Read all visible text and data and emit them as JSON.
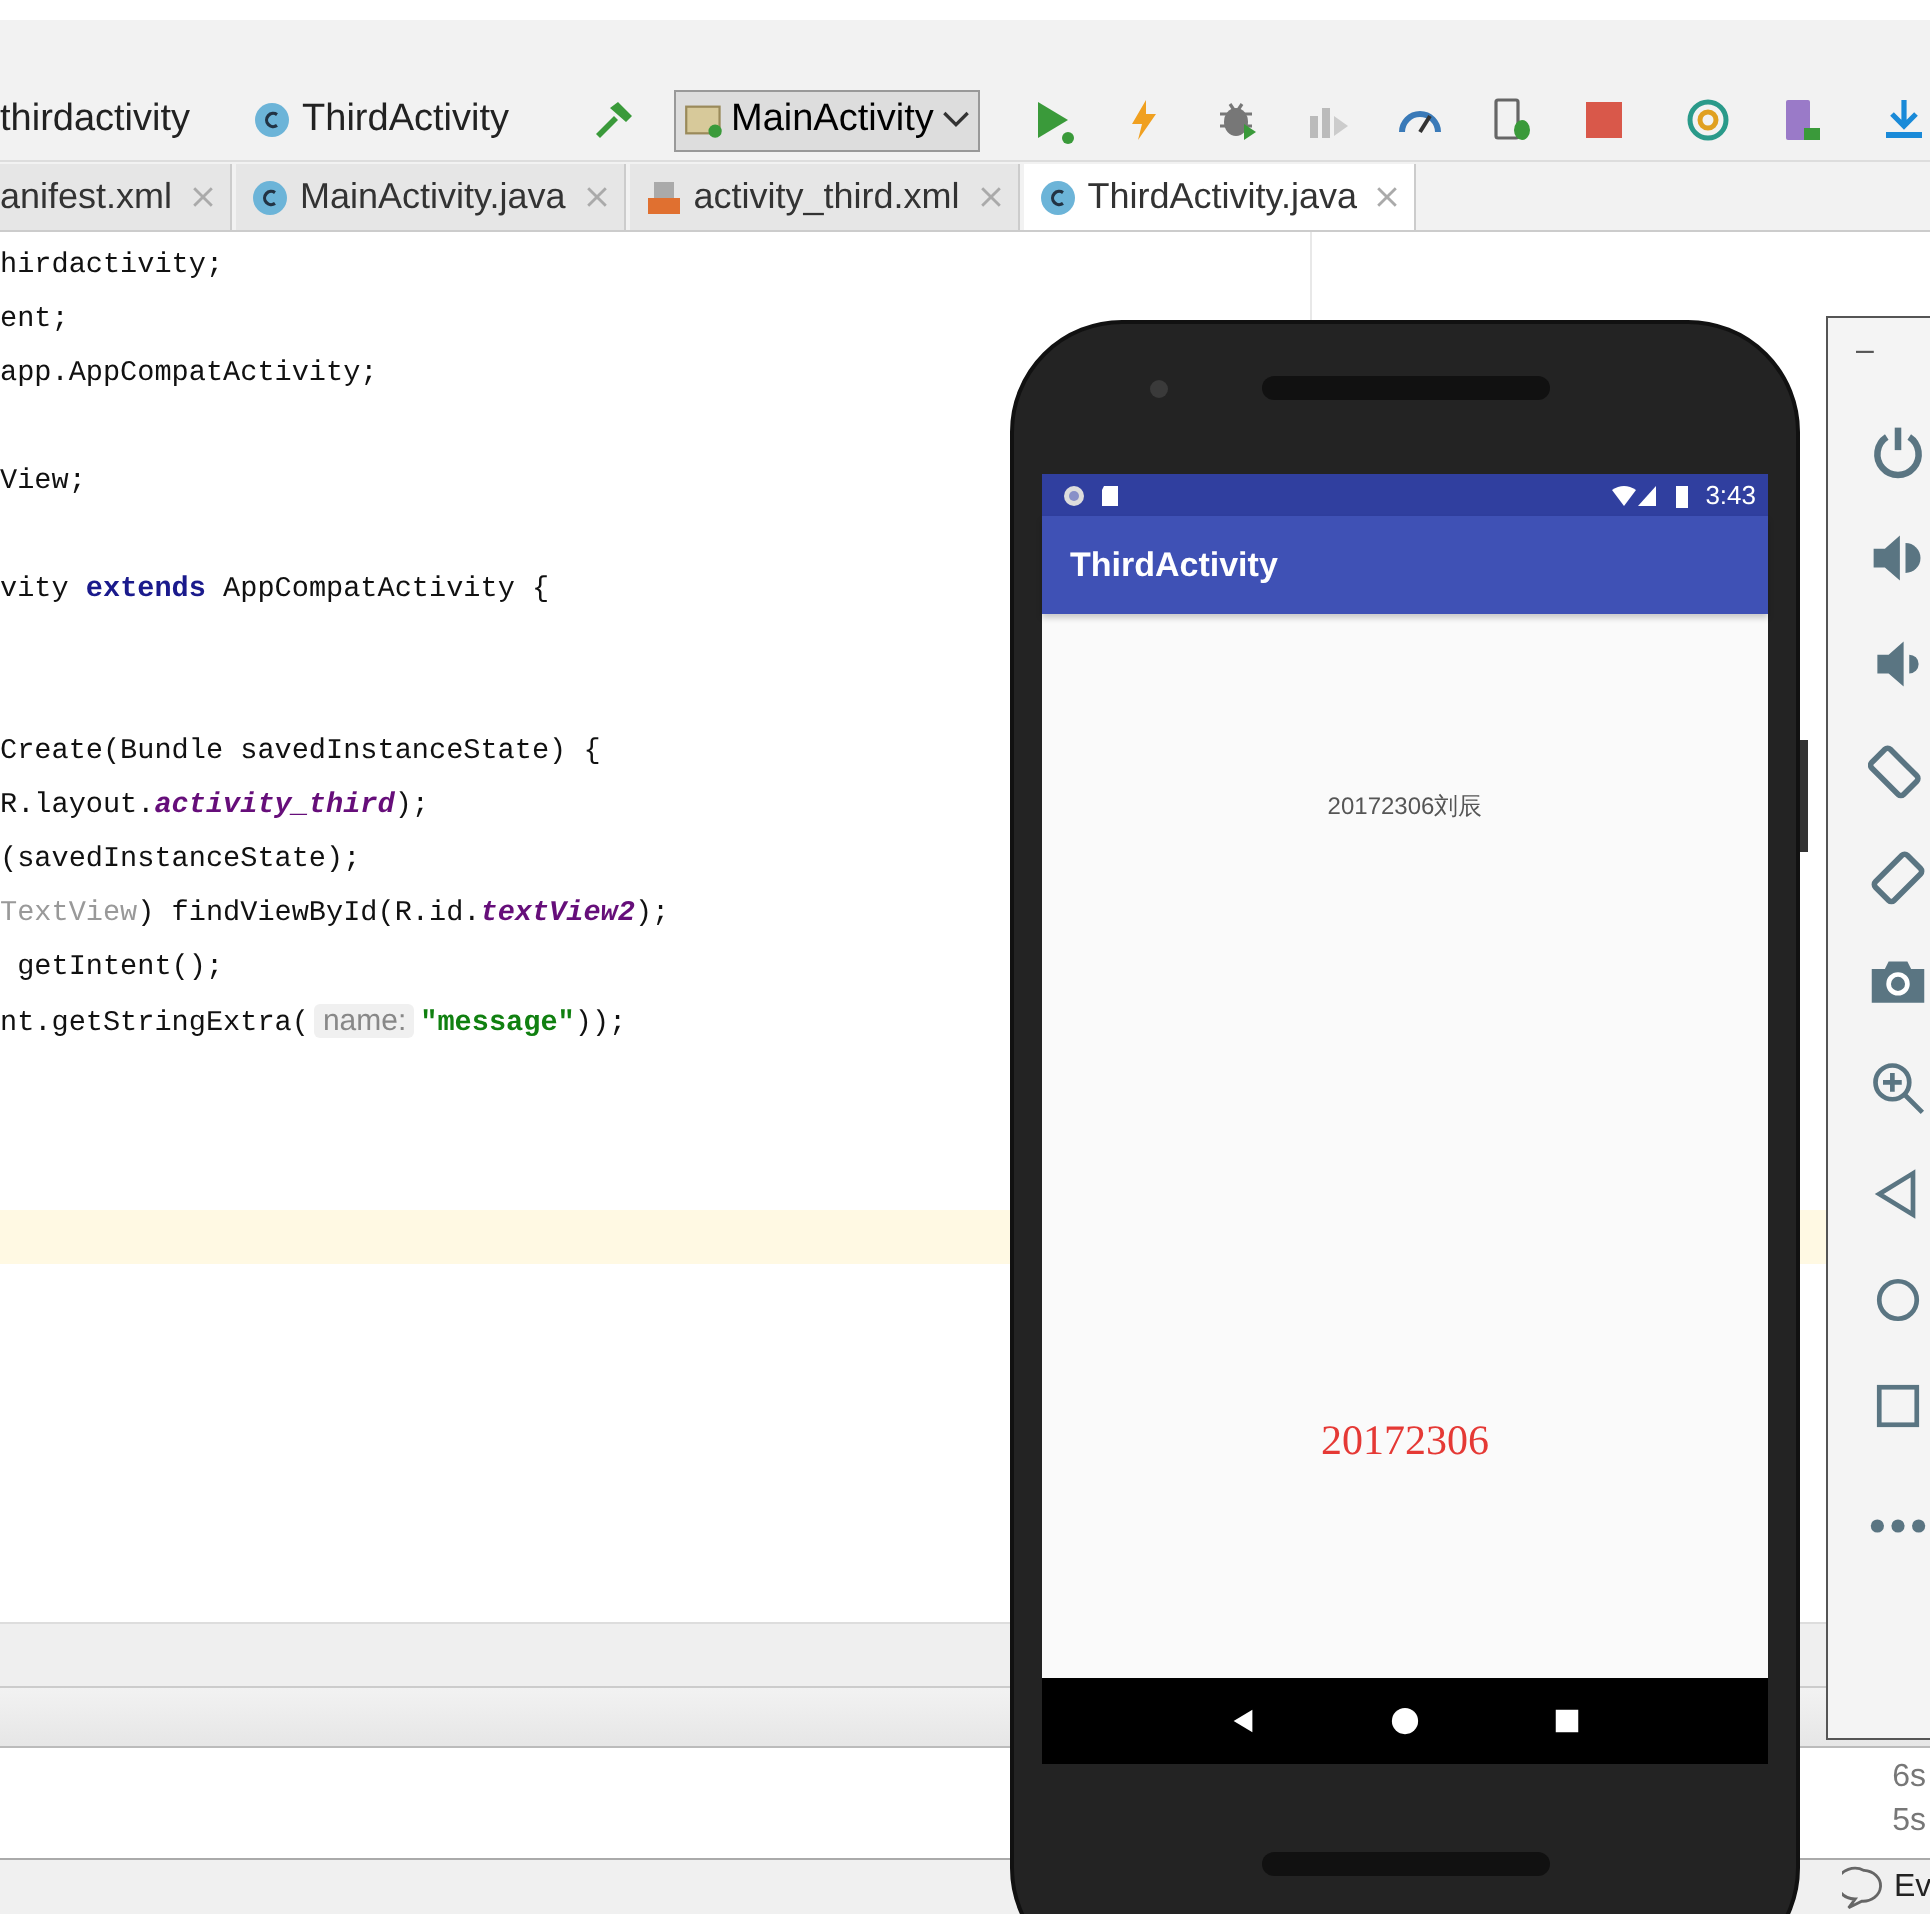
{
  "breadcrumb": [
    {
      "label": "thirdactivity",
      "kind": "package"
    },
    {
      "label": "ThirdActivity",
      "kind": "class"
    }
  ],
  "run_config": {
    "label": "MainActivity"
  },
  "tabs": [
    {
      "label": "anifest.xml",
      "kind": "manifest",
      "selected": false
    },
    {
      "label": "MainActivity.java",
      "kind": "class",
      "selected": false
    },
    {
      "label": "activity_third.xml",
      "kind": "layout",
      "selected": false
    },
    {
      "label": "ThirdActivity.java",
      "kind": "class",
      "selected": true
    }
  ],
  "editor": {
    "lines": [
      {
        "current": false,
        "segments": [
          {
            "kind": "plain",
            "text": "hirdactivity;"
          }
        ]
      },
      {
        "current": false,
        "segments": [
          {
            "kind": "plain",
            "text": "ent;"
          }
        ]
      },
      {
        "current": false,
        "segments": [
          {
            "kind": "plain",
            "text": "app.AppCompatActivity;"
          }
        ]
      },
      {
        "current": false
      },
      {
        "current": false,
        "segments": [
          {
            "kind": "plain",
            "text": "View;"
          }
        ]
      },
      {
        "current": false
      },
      {
        "current": false,
        "segments": [
          {
            "kind": "plain",
            "text": "vity "
          },
          {
            "kind": "keyword",
            "text": "extends"
          },
          {
            "kind": "plain",
            "text": " AppCompatActivity {"
          }
        ]
      },
      {
        "current": false
      },
      {
        "current": false
      },
      {
        "current": false,
        "segments": [
          {
            "kind": "plain",
            "text": "Create(Bundle savedInstanceState) {"
          }
        ]
      },
      {
        "current": false,
        "segments": [
          {
            "kind": "plain",
            "text": "R.layout."
          },
          {
            "kind": "field",
            "text": "activity_third"
          },
          {
            "kind": "plain",
            "text": ");"
          }
        ]
      },
      {
        "current": false,
        "segments": [
          {
            "kind": "plain",
            "text": "(savedInstanceState);"
          }
        ]
      },
      {
        "current": false,
        "segments": [
          {
            "kind": "muted",
            "text": "TextView"
          },
          {
            "kind": "plain",
            "text": ") findViewById(R.id."
          },
          {
            "kind": "field",
            "text": "textView2"
          },
          {
            "kind": "plain",
            "text": ");"
          }
        ]
      },
      {
        "current": false,
        "segments": [
          {
            "kind": "plain",
            "text": " getIntent();"
          }
        ]
      },
      {
        "current": false,
        "segments": [
          {
            "kind": "plain",
            "text": "nt.getStringExtra("
          },
          {
            "kind": "hint",
            "text": "name:"
          },
          {
            "kind": "string",
            "text": "\"message\""
          },
          {
            "kind": "plain",
            "text": "));"
          }
        ]
      },
      {
        "current": false
      },
      {
        "current": false
      },
      {
        "current": false
      },
      {
        "current": true
      }
    ]
  },
  "emulator": {
    "status_time": "3:43",
    "app_title": "ThirdActivity",
    "texts": [
      {
        "text": "20172306刘辰",
        "kind": "small"
      },
      {
        "text": "20172306",
        "kind": "large"
      }
    ]
  },
  "emulator_panel": {
    "minimize": "–"
  },
  "run_log": [
    "6s",
    "5s"
  ],
  "status_bar": {
    "text": "Ev"
  }
}
